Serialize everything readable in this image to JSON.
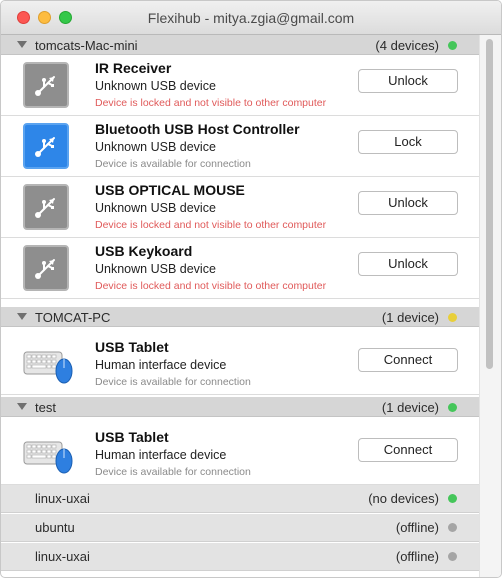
{
  "window": {
    "title": "Flexihub - mitya.zgia@gmail.com"
  },
  "colors": {
    "online": "#45c65a",
    "pending": "#e8cf3a",
    "offline": "#a5a5a5",
    "locked_text": "#e05a5a"
  },
  "groups": [
    {
      "name": "tomcats-Mac-mini",
      "count": "(4 devices)",
      "status": "online",
      "devices": [
        {
          "icon": "usb-icon",
          "name": "IR Receiver",
          "type": "Unknown USB device",
          "status": "Device is locked and not visible to other computer",
          "action": "Unlock"
        },
        {
          "icon": "usb-icon",
          "name": "Bluetooth USB Host Controller",
          "type": "Unknown USB device",
          "status": "Device is available for connection",
          "action": "Lock"
        },
        {
          "icon": "usb-icon",
          "name": "USB OPTICAL MOUSE",
          "type": "Unknown USB device",
          "status": "Device is locked and not visible to other computer",
          "action": "Unlock"
        },
        {
          "icon": "usb-icon",
          "name": "USB Keykoard",
          "type": "Unknown USB device",
          "status": "Device is locked and not visible to other computer",
          "action": "Unlock"
        }
      ]
    },
    {
      "name": "TOMCAT-PC",
      "count": "(1 device)",
      "status": "pending",
      "devices": [
        {
          "icon": "keyboard-mouse-icon",
          "name": "USB Tablet",
          "type": "Human interface device",
          "status": "Device is available for connection",
          "action": "Connect"
        }
      ]
    },
    {
      "name": "test",
      "count": "(1 device)",
      "status": "online",
      "devices": [
        {
          "icon": "keyboard-mouse-icon",
          "name": "USB Tablet",
          "type": "Human interface device",
          "status": "Device is available for connection",
          "action": "Connect"
        }
      ]
    }
  ],
  "other_computers": [
    {
      "name": "linux-uxai",
      "status_text": "(no devices)",
      "status": "online"
    },
    {
      "name": "ubuntu",
      "status_text": "(offline)",
      "status": "offline"
    },
    {
      "name": "linux-uxai",
      "status_text": "(offline)",
      "status": "offline"
    }
  ]
}
